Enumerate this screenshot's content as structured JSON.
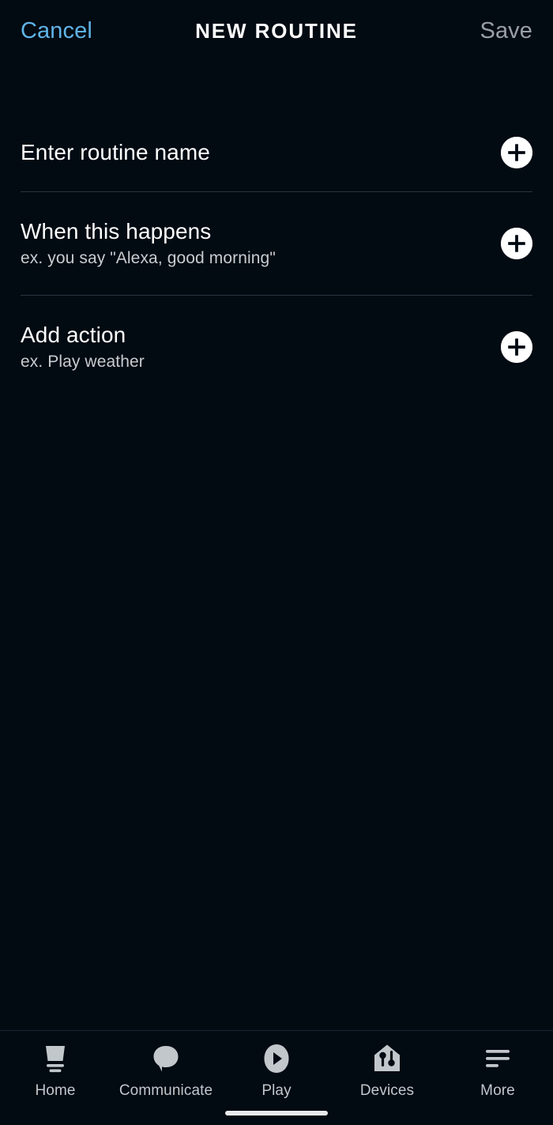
{
  "header": {
    "cancel_label": "Cancel",
    "title": "NEW ROUTINE",
    "save_label": "Save",
    "cancel_color": "#5fb4e8",
    "save_color": "#9aa0a6"
  },
  "list": {
    "rows": [
      {
        "title": "Enter routine name",
        "subtitle": "",
        "action_icon": "plus-icon"
      },
      {
        "title": "When this happens",
        "subtitle": "ex. you say \"Alexa, good morning\"",
        "action_icon": "plus-icon"
      },
      {
        "title": "Add action",
        "subtitle": "ex. Play weather",
        "action_icon": "plus-icon"
      }
    ]
  },
  "bottom_nav": {
    "items": [
      {
        "label": "Home",
        "icon": "echo-device-icon"
      },
      {
        "label": "Communicate",
        "icon": "speech-bubble-icon"
      },
      {
        "label": "Play",
        "icon": "play-circle-icon"
      },
      {
        "label": "Devices",
        "icon": "house-sliders-icon"
      },
      {
        "label": "More",
        "icon": "hamburger-lines-icon"
      }
    ]
  },
  "theme": {
    "background": "#020a12",
    "divider": "#2a3440",
    "icon_color": "#c2c7cc",
    "accent_white": "#ffffff"
  }
}
